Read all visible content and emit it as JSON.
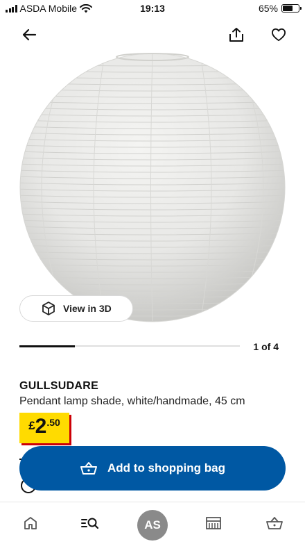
{
  "status_bar": {
    "carrier": "ASDA Mobile",
    "time": "19:13",
    "battery": "65%",
    "battery_level": 0.65
  },
  "header": {
    "back_icon": "arrow-left-icon",
    "share_icon": "share-icon",
    "favourite_icon": "heart-icon"
  },
  "gallery": {
    "view_3d_label": "View in 3D",
    "view_3d_icon": "cube-icon",
    "counter": "1 of 4",
    "progress": 0.25
  },
  "product": {
    "name": "GULLSUDARE",
    "description": "Pendant lamp shade, white/handmade, 45 cm",
    "price": {
      "currency": "£",
      "integer": "2",
      "decimal": ".50"
    }
  },
  "cta": {
    "label": "Add to shopping bag",
    "icon": "basket-icon",
    "color": "#0058a3"
  },
  "bottom_nav": {
    "items": [
      "home-icon",
      "search-list-icon",
      "avatar",
      "store-icon",
      "basket-icon"
    ],
    "avatar_initials": "AS"
  },
  "colors": {
    "price_tag": "#ffdb00",
    "price_shadow": "#cc0008"
  }
}
